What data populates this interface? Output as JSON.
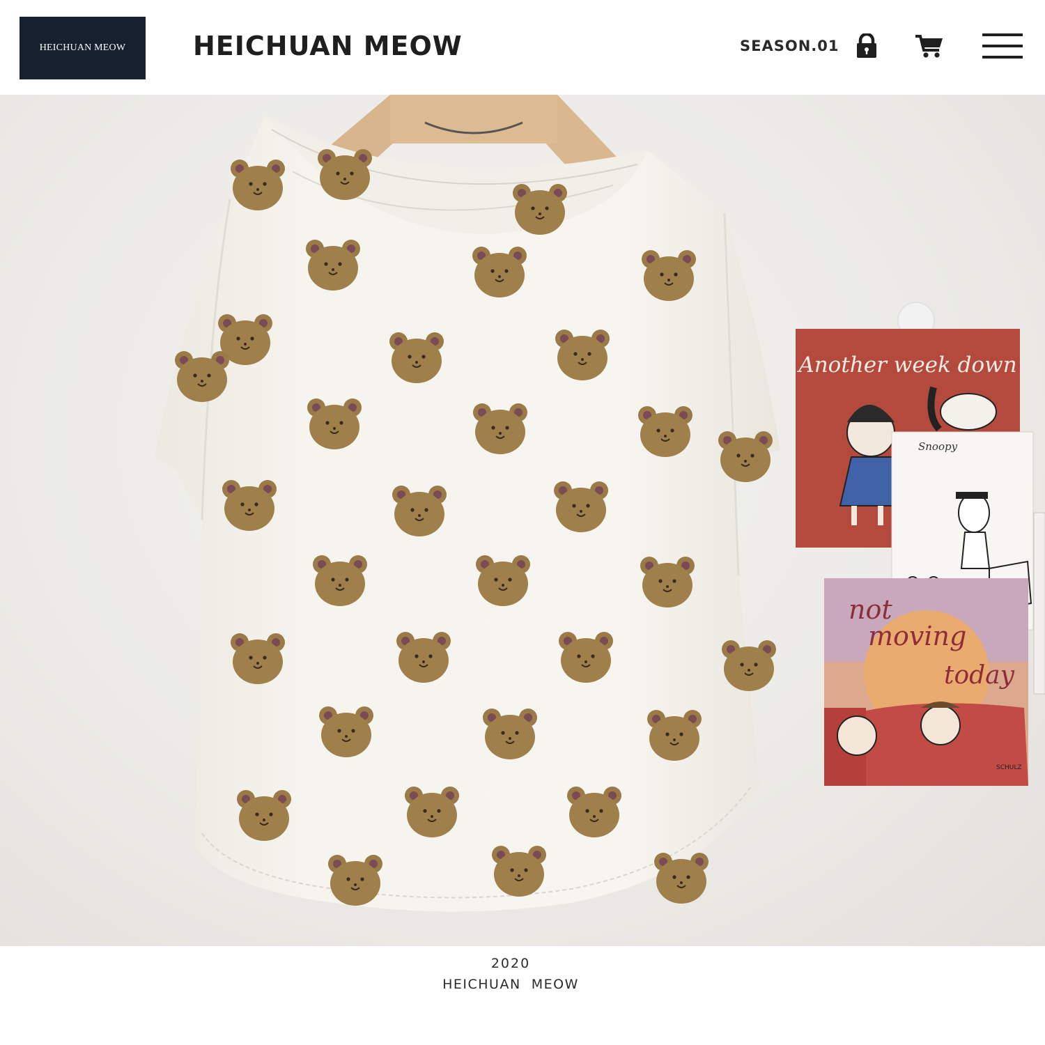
{
  "header": {
    "logo_text": "HEICHUAN MEOW",
    "brand": "HEICHUAN MEOW",
    "season": "SEASON.01",
    "icons": [
      "lock-icon",
      "cart-icon",
      "menu-icon"
    ]
  },
  "photo": {
    "postcards": {
      "red_card_text": "Another week down",
      "snoopy_card_text": "Snoopy",
      "sofa_card_text_line1": "not",
      "sofa_card_text_line2": "moving",
      "sofa_card_text_line3": "today",
      "sofa_card_signature": "SCHULZ"
    }
  },
  "footer": {
    "year": "2020",
    "brand": "HEICHUAN  MEOW"
  },
  "colors": {
    "logo_bg": "#16202f",
    "text_dark": "#1f1f1f",
    "bear_brown": "#9a7a46",
    "red_card": "#b4493e"
  }
}
